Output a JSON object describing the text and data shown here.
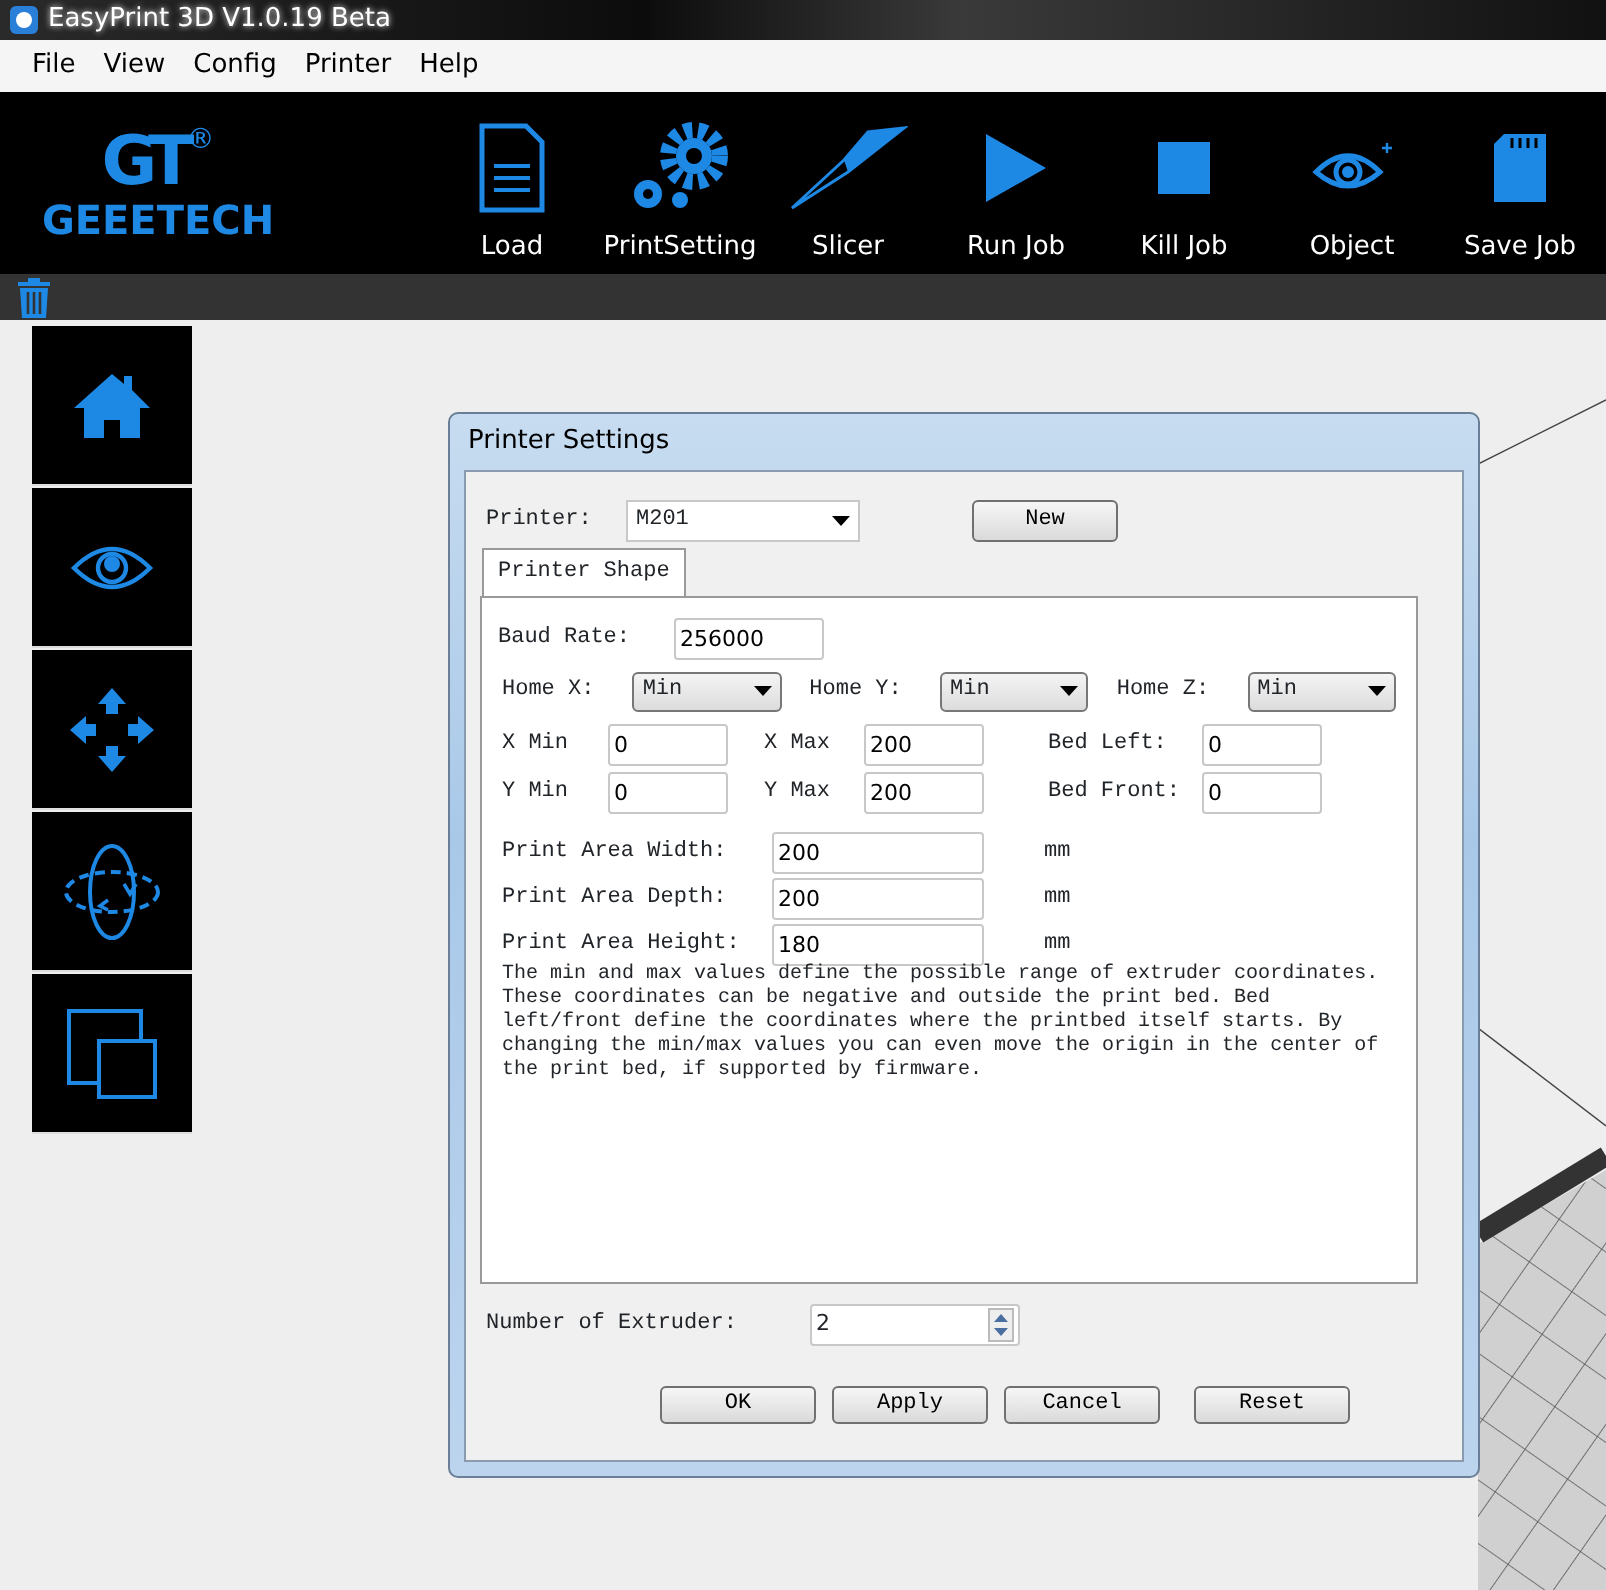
{
  "window": {
    "title": "EasyPrint 3D  V1.0.19 Beta"
  },
  "menu": [
    "File",
    "View",
    "Config",
    "Printer",
    "Help"
  ],
  "logo": {
    "mark": "GT",
    "registered": "®",
    "text": "GEEETECH"
  },
  "toolbar": [
    {
      "kind": "load",
      "label": "Load"
    },
    {
      "kind": "settings",
      "label": "PrintSetting"
    },
    {
      "kind": "slicer",
      "label": "Slicer"
    },
    {
      "kind": "run",
      "label": "Run Job"
    },
    {
      "kind": "kill",
      "label": "Kill Job"
    },
    {
      "kind": "object",
      "label": "Object"
    },
    {
      "kind": "save",
      "label": "Save Job"
    }
  ],
  "sidebar": {
    "items": [
      {
        "kind": "home"
      },
      {
        "kind": "view"
      },
      {
        "kind": "move"
      },
      {
        "kind": "rotate"
      },
      {
        "kind": "copy"
      }
    ]
  },
  "dialog": {
    "title": "Printer Settings",
    "printer": {
      "label": "Printer:",
      "value": "M201"
    },
    "new_button": "New",
    "tabs": [
      {
        "label": "Printer Shape",
        "selected": true
      }
    ],
    "baud_rate": {
      "label": "Baud Rate:",
      "value": "256000"
    },
    "home": [
      {
        "label": "Home X:",
        "value": "Min"
      },
      {
        "label": "Home Y:",
        "value": "Min"
      },
      {
        "label": "Home Z:",
        "value": "Min"
      }
    ],
    "coordinates": [
      [
        {
          "label": "X Min",
          "value": "0"
        },
        {
          "label": "X Max",
          "value": "200"
        },
        {
          "label": "Bed Left:",
          "value": "0"
        }
      ],
      [
        {
          "label": "Y Min",
          "value": "0"
        },
        {
          "label": "Y Max",
          "value": "200"
        },
        {
          "label": "Bed Front:",
          "value": "0"
        }
      ]
    ],
    "print_area": [
      {
        "label": "Print Area Width:",
        "value": "200",
        "unit": "mm"
      },
      {
        "label": "Print Area Depth:",
        "value": "200",
        "unit": "mm"
      },
      {
        "label": "Print Area Height:",
        "value": "180",
        "unit": "mm"
      }
    ],
    "description": "The min and max values define the possible range of extruder coordinates. These coordinates can be negative and outside the print bed. Bed left/front define the coordinates where the printbed itself starts. By changing the min/max values you can even move the origin in the center of the print bed, if supported by firmware.",
    "extruders": {
      "label": "Number of Extruder:",
      "value": "2"
    },
    "buttons": [
      "OK",
      "Apply",
      "Cancel",
      "Reset"
    ]
  }
}
